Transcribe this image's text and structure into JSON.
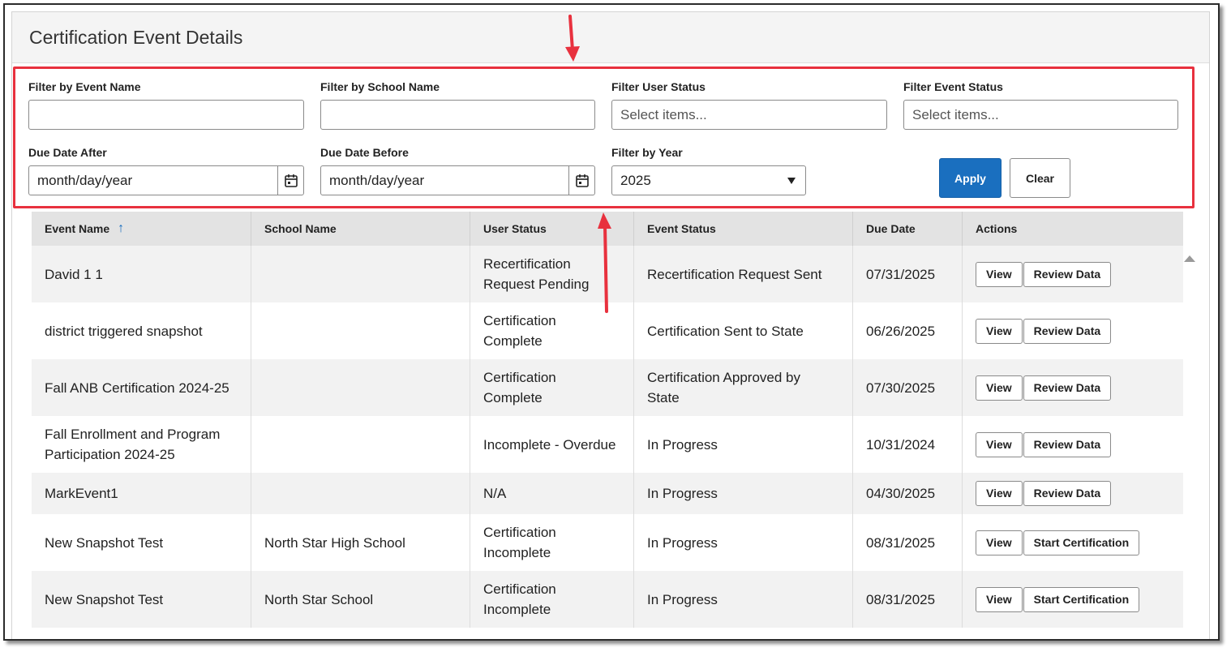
{
  "page": {
    "title": "Certification Event Details"
  },
  "filters": {
    "event_name_label": "Filter by Event Name",
    "event_name_value": "",
    "school_name_label": "Filter by School Name",
    "school_name_value": "",
    "user_status_label": "Filter User Status",
    "user_status_placeholder": "Select items...",
    "event_status_label": "Filter Event Status",
    "event_status_placeholder": "Select items...",
    "due_after_label": "Due Date After",
    "due_after_value": "month/day/year",
    "due_before_label": "Due Date Before",
    "due_before_value": "month/day/year",
    "year_label": "Filter by Year",
    "year_value": "2025",
    "apply_label": "Apply",
    "clear_label": "Clear"
  },
  "table": {
    "headers": [
      "Event Name",
      "School Name",
      "User Status",
      "Event Status",
      "Due Date",
      "Actions"
    ],
    "sort_icon": "↑",
    "rows": [
      {
        "event": "David 1 1",
        "school": "",
        "user_status": "Recertification\nRequest Pending",
        "event_status": "Recertification Request Sent",
        "due": "07/31/2025",
        "actions": [
          "View",
          "Review Data"
        ]
      },
      {
        "event": "district triggered snapshot",
        "school": "",
        "user_status": "Certification\nComplete",
        "event_status": "Certification Sent to State",
        "due": "06/26/2025",
        "actions": [
          "View",
          "Review Data"
        ]
      },
      {
        "event": "Fall ANB Certification 2024-25",
        "school": "",
        "user_status": "Certification\nComplete",
        "event_status": "Certification Approved by\nState",
        "due": "07/30/2025",
        "actions": [
          "View",
          "Review Data"
        ]
      },
      {
        "event": "Fall Enrollment and Program\nParticipation 2024-25",
        "school": "",
        "user_status": "Incomplete - Overdue",
        "event_status": "In Progress",
        "due": "10/31/2024",
        "actions": [
          "View",
          "Review Data"
        ]
      },
      {
        "event": "MarkEvent1",
        "school": "",
        "user_status": "N/A",
        "event_status": "In Progress",
        "due": "04/30/2025",
        "actions": [
          "View",
          "Review Data"
        ]
      },
      {
        "event": "New Snapshot Test",
        "school": "North Star High School",
        "user_status": "Certification\nIncomplete",
        "event_status": "In Progress",
        "due": "08/31/2025",
        "actions": [
          "View",
          "Start Certification"
        ]
      },
      {
        "event": "New Snapshot Test",
        "school": "North Star School",
        "user_status": "Certification\nIncomplete",
        "event_status": "In Progress",
        "due": "08/31/2025",
        "actions": [
          "View",
          "Start Certification"
        ]
      }
    ]
  },
  "icons": {
    "calendar": "calendar-icon",
    "caret": "caret-down-icon",
    "scroll_up": "scroll-up-arrow-icon",
    "annotation_arrow": "red-annotation-arrow-icon"
  },
  "colors": {
    "highlight": "#e8313e",
    "apply_button": "#1a6fbf",
    "header_bg": "#e3e3e3",
    "row_alt": "#f2f2f2"
  }
}
